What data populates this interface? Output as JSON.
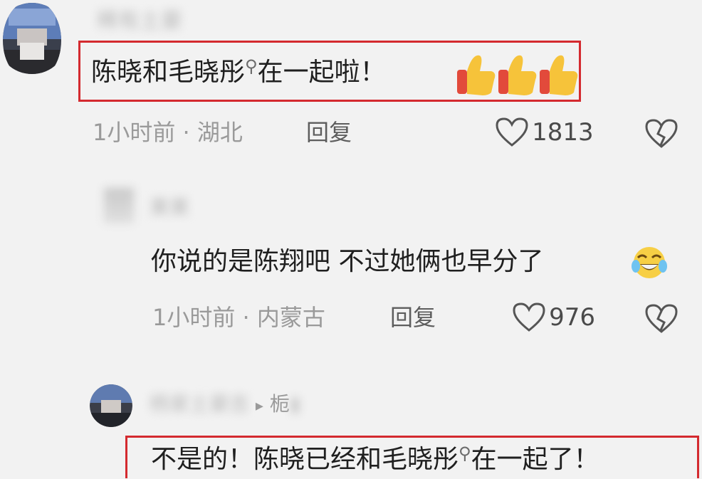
{
  "comment1": {
    "username": "稀有土豪",
    "text": "陈晓和毛晓彤",
    "text_tail": "在一起啦！",
    "reactions": [
      "thumbs-up",
      "thumbs-up",
      "thumbs-up"
    ],
    "time": "1小时前",
    "location": "湖北",
    "reply_label": "回复",
    "likes": "1813",
    "like_icon": "heart-outline-icon",
    "dislike_icon": "broken-heart-icon"
  },
  "reply1": {
    "username": "果果",
    "text": "你说的是陈翔吧 不过她俩也早分了",
    "emoji": "laughing-crying-emoji",
    "time": "1小时前",
    "location": "内蒙古",
    "reply_label": "回复",
    "likes": "976"
  },
  "reply2": {
    "username": "杨家土豪吉",
    "arrow": "▸",
    "reply_to": "栀",
    "text": "不是的！陈晓已经和毛晓彤",
    "text_tail": "在一起了！"
  },
  "colors": {
    "highlight_border": "#d42a2f",
    "background": "#f2f2f2",
    "meta_gray": "#9a9a9a"
  }
}
